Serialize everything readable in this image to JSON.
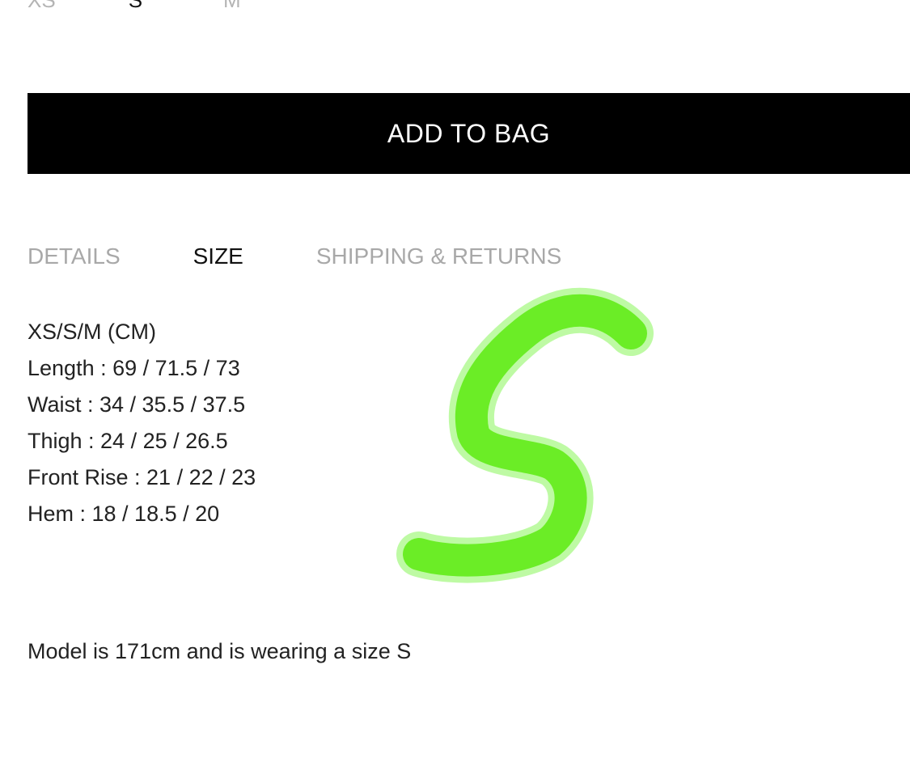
{
  "size_selector": {
    "options": [
      "XS",
      "S",
      "M"
    ],
    "selected": "S"
  },
  "add_to_bag": {
    "label": "ADD TO BAG"
  },
  "tabs": [
    {
      "label": "DETAILS",
      "active": false
    },
    {
      "label": "SIZE",
      "active": true
    },
    {
      "label": "SHIPPING & RETURNS",
      "active": false
    }
  ],
  "size_info": {
    "heading": "XS/S/M (CM)",
    "rows": [
      "Length : 69 / 71.5 / 73",
      "Waist : 34 / 35.5 / 37.5",
      "Thigh : 24 / 25 / 26.5",
      "Front Rise : 21 / 22 / 23",
      "Hem : 18 / 18.5 / 20"
    ]
  },
  "model_note": "Model is 171cm and is wearing a size S",
  "annotation": {
    "color": "#66f01a"
  }
}
